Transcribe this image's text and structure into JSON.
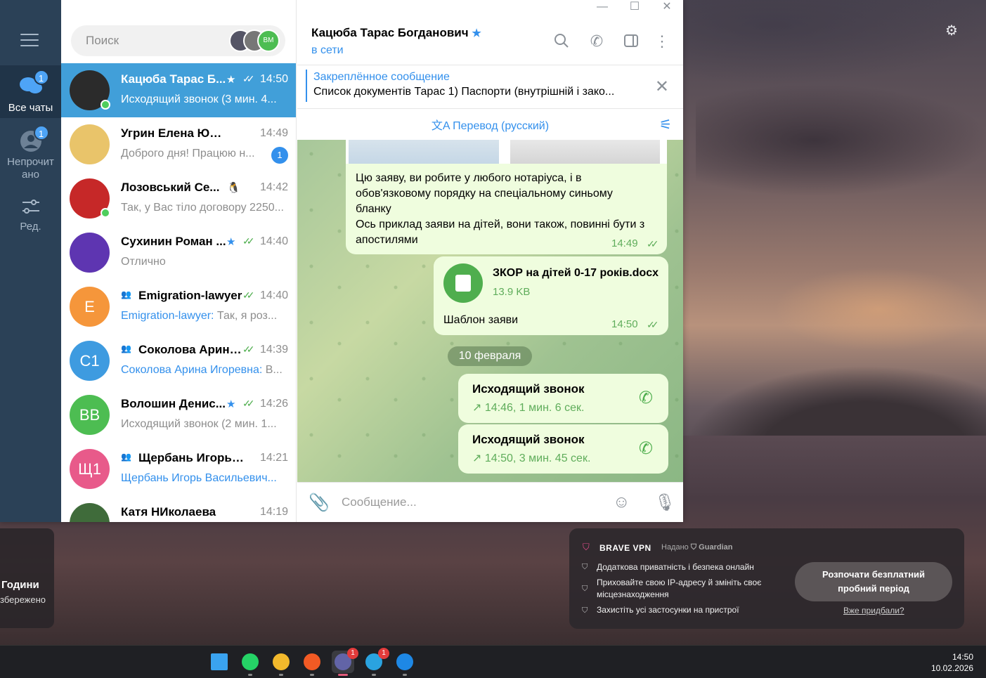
{
  "window": {
    "minimize": "—",
    "maximize": "☐",
    "close": "✕"
  },
  "rail": {
    "all_chats": {
      "label": "Все чаты",
      "badge": "1"
    },
    "unread": {
      "label_line1": "Непрочит",
      "label_line2": "ано",
      "badge": "1"
    },
    "edit": {
      "label": "Ред."
    }
  },
  "search": {
    "placeholder": "Поиск",
    "avatar_label": "ВМ"
  },
  "chats": [
    {
      "name": "Кацюба Тарас Б...",
      "time": "14:50",
      "preview": "Исходящий звонок (3 мин. 4...",
      "selected": true,
      "avatar_color": "#2b2b2b",
      "initials": "",
      "online": true
    },
    {
      "name": "Угрин Елена Юрьевна",
      "time": "14:49",
      "preview": "Доброго дня! Працюю н...",
      "unread": "1",
      "avatar_color": "#e9c46a",
      "initials": ""
    },
    {
      "name": "Лозовський Се...",
      "time": "14:42",
      "preview": "Так, у Вас тіло договору 2250...",
      "avatar_color": "#c62828",
      "initials": "",
      "online": true
    },
    {
      "name": "Сухинин Роман ...",
      "time": "14:40",
      "preview": "Отлично",
      "avatar_color": "#5e35b1",
      "initials": ""
    },
    {
      "name": "Emigration-lawyer",
      "time": "14:40",
      "author": "Emigration-lawyer:",
      "preview": " Так, я роз...",
      "avatar_color": "#f5963b",
      "initials": "E"
    },
    {
      "name": "Соколова Арина И...",
      "time": "14:39",
      "author": "Соколова Арина Игоревна:",
      "preview": " В...",
      "avatar_color": "#3e9be0",
      "initials": "С1"
    },
    {
      "name": "Волошин Денис...",
      "time": "14:26",
      "preview": "Исходящий звонок (2 мин. 1...",
      "avatar_color": "#4dbd52",
      "initials": "ВВ"
    },
    {
      "name": "Щербань Игорь Ва...",
      "time": "14:21",
      "author": "Щербань Игорь Васильевич...",
      "preview": "",
      "avatar_color": "#e85a8a",
      "initials": "Щ1"
    },
    {
      "name": "Катя НИколаева",
      "time": "14:19",
      "preview": "",
      "avatar_color": "#3f6b3a",
      "initials": ""
    }
  ],
  "header": {
    "name": "Кацюба Тарас Богданович",
    "status": "в сети"
  },
  "pinned": {
    "title": "Закреплённое сообщение",
    "text": "Список документів Тарас  1) Паспорти (внутрішній і зако..."
  },
  "translate": {
    "label": "Перевод (русский)"
  },
  "messages": {
    "text_msg": {
      "lines": [
        "Цю заяву, ви робите у любого нотаріуса, і в",
        "обов'язковому порядку на спеціальному синьому",
        "бланку",
        "Ось приклад заяви на дітей, вони також, повинні бути з",
        "апостилями"
      ],
      "time": "14:49"
    },
    "doc_msg": {
      "file_name": "ЗКОР на дітей 0-17 років.docx",
      "file_size": "13.9 KB",
      "caption": "Шаблон заяви",
      "time": "14:50"
    },
    "date": "10 февраля",
    "calls": [
      {
        "title": "Исходящий звонок",
        "detail": "14:46, 1 мин. 6 сек."
      },
      {
        "title": "Исходящий звонок",
        "detail": "14:50, 3 мин. 45 сек."
      }
    ]
  },
  "composer": {
    "placeholder": "Сообщение..."
  },
  "widget_left": {
    "line1": "Години",
    "line2": "збережено"
  },
  "vpn": {
    "title": "BRAVE VPN",
    "by": "Надано",
    "guardian": "Guardian",
    "features": [
      "Додаткова приватність і безпека онлайн",
      "Приховайте свою IP-адресу й змініть своє",
      "місцезнаходження",
      "Захистіть усі застосунки на пристрої"
    ],
    "cta_line1": "Розпочати безплатний",
    "cta_line2": "пробний період",
    "link": "Вже придбали?"
  },
  "taskbar": {
    "apps": [
      {
        "name": "windows-start",
        "color": "#3aa3f0"
      },
      {
        "name": "whatsapp",
        "color": "#25d366"
      },
      {
        "name": "file-explorer",
        "color": "#f2b92c"
      },
      {
        "name": "brave",
        "color": "#f25a24"
      },
      {
        "name": "teams",
        "color": "#6264a7",
        "badge": "1"
      },
      {
        "name": "telegram",
        "color": "#2aa3e0",
        "badge": "1"
      },
      {
        "name": "browser-globe",
        "color": "#1e88e5"
      }
    ],
    "time": "14:50",
    "date": "10.02.2026"
  }
}
